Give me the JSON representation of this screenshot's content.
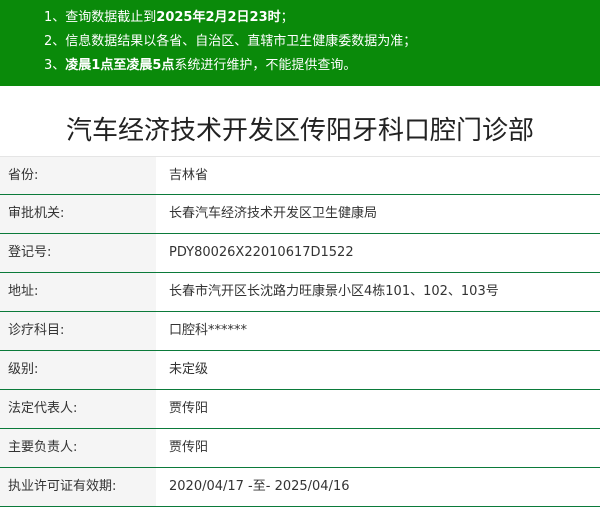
{
  "notice": {
    "line1_prefix": "1、查询数据截止到",
    "line1_bold": "2025年2月2日23时",
    "line1_suffix": "；",
    "line2": "2、信息数据结果以各省、自治区、直辖市卫生健康委数据为准；",
    "line3_prefix": "3、",
    "line3_bold": "凌晨1点至凌晨5点",
    "line3_suffix": "系统进行维护，不能提供查询。"
  },
  "title": "汽车经济技术开发区传阳牙科口腔门诊部",
  "rows": [
    {
      "label": "省份:",
      "value": "吉林省"
    },
    {
      "label": "审批机关:",
      "value": "长春汽车经济技术开发区卫生健康局"
    },
    {
      "label": "登记号:",
      "value": "PDY80026X22010617D1522"
    },
    {
      "label": "地址:",
      "value": "长春市汽开区长沈路力旺康景小区4栋101、102、103号"
    },
    {
      "label": "诊疗科目:",
      "value": "口腔科******"
    },
    {
      "label": "级别:",
      "value": "未定级"
    },
    {
      "label": "法定代表人:",
      "value": "贾传阳"
    },
    {
      "label": "主要负责人:",
      "value": "贾传阳"
    },
    {
      "label": "执业许可证有效期:",
      "value": "2020/04/17 -至- 2025/04/16"
    }
  ],
  "colors": {
    "notice_bg": "#0a8a0a",
    "row_border": "#0b7a3a",
    "label_bg": "#f5f5f5"
  }
}
